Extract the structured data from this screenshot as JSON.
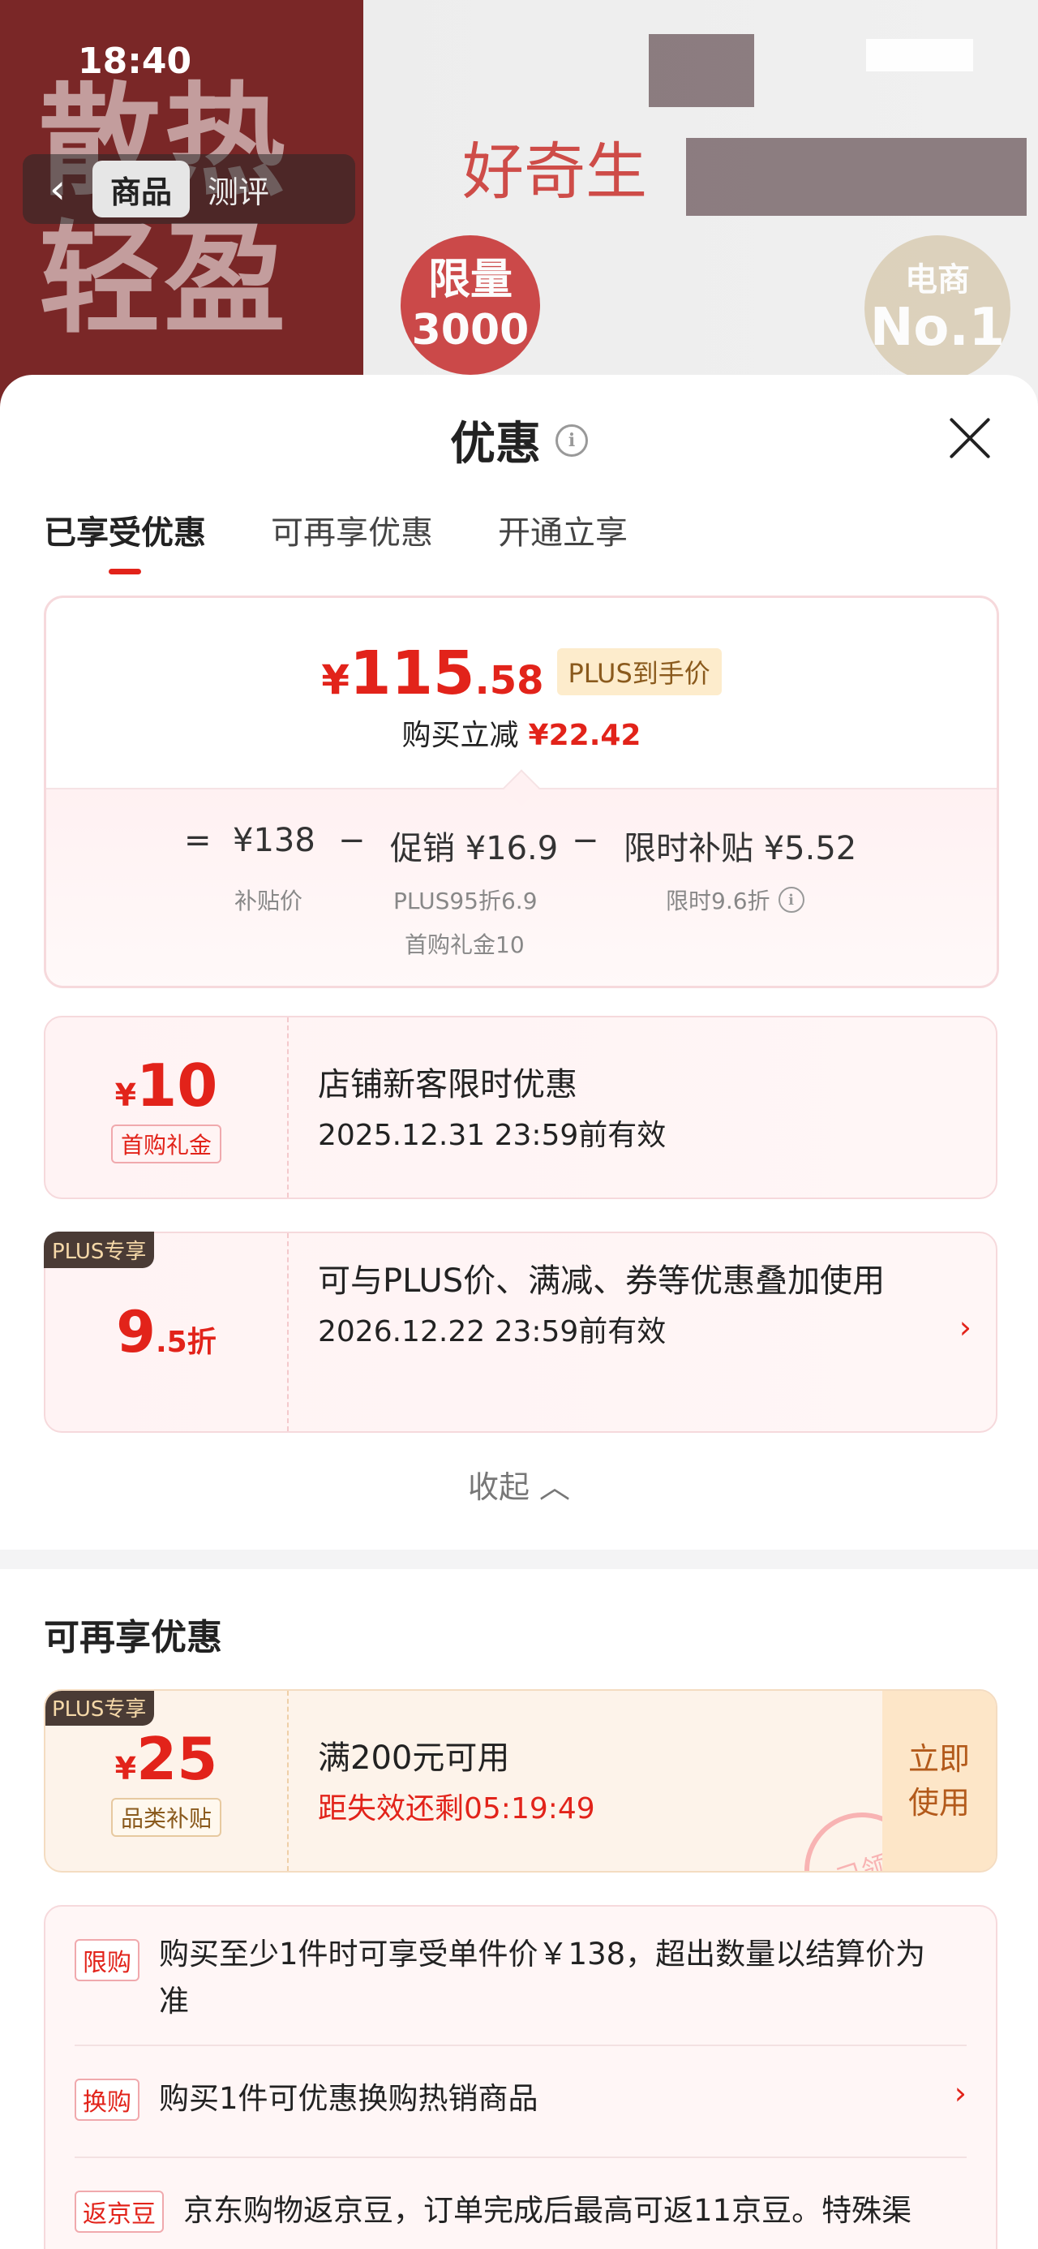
{
  "status_bar": {
    "time": "18:40"
  },
  "product_header": {
    "promo_text_line1": "散热",
    "promo_text_line2": "轻盈",
    "brand_text": "好奇生",
    "badge_limit_line1": "限量",
    "badge_limit_line2": "3000",
    "badge_rank_line1": "电商",
    "badge_rank_line2": "No.1"
  },
  "nav": {
    "tabs": [
      "商品",
      "测评"
    ],
    "active_tab": "商品"
  },
  "sheet": {
    "title": "优惠",
    "tabs": [
      "已享受优惠",
      "可再享优惠",
      "开通立享"
    ],
    "active_tab": "已享受优惠"
  },
  "price_summary": {
    "currency": "¥",
    "price_integer": "115",
    "price_decimal": ".58",
    "price_tag": "PLUS到手价",
    "save_label": "购买立减",
    "save_amount": "¥22.42",
    "formula": {
      "equals": "=",
      "base_price": "¥138",
      "base_label": "补贴价",
      "minus1": "−",
      "promo": "促销 ¥16.9",
      "promo_detail1": "PLUS95折6.9",
      "promo_detail2": "首购礼金10",
      "minus2": "−",
      "subsidy": "限时补贴 ¥5.52",
      "subsidy_detail": "限时9.6折"
    }
  },
  "coupons": [
    {
      "currency": "¥",
      "amount": "10",
      "label": "首购礼金",
      "title": "店铺新客限时优惠",
      "valid": "2025.12.31 23:59前有效"
    },
    {
      "ribbon": "PLUS专享",
      "discount_big": "9",
      "discount_small": ".5折",
      "title": "可与PLUS价、满减、券等优惠叠加使用",
      "valid": "2026.12.22 23:59前有效",
      "chevron": "›"
    }
  ],
  "collapse_label": "收起",
  "more_section": {
    "title": "可再享优惠",
    "coupon": {
      "ribbon": "PLUS专享",
      "currency": "¥",
      "amount": "25",
      "label": "品类补贴",
      "title": "满200元可用",
      "countdown": "距失效还剩05:19:49",
      "action_line1": "立即",
      "action_line2": "使用",
      "stamp": "已领"
    }
  },
  "rules": [
    {
      "tag": "限购",
      "text": "购买至少1件时可享受单件价￥138，超出数量以结算价为准"
    },
    {
      "tag": "换购",
      "text": "购买1件可优惠换购热销商品",
      "chevron": "›"
    },
    {
      "tag": "返京豆",
      "text": "京东购物返京豆，订单完成后最高可返11京豆。特殊渠"
    }
  ]
}
